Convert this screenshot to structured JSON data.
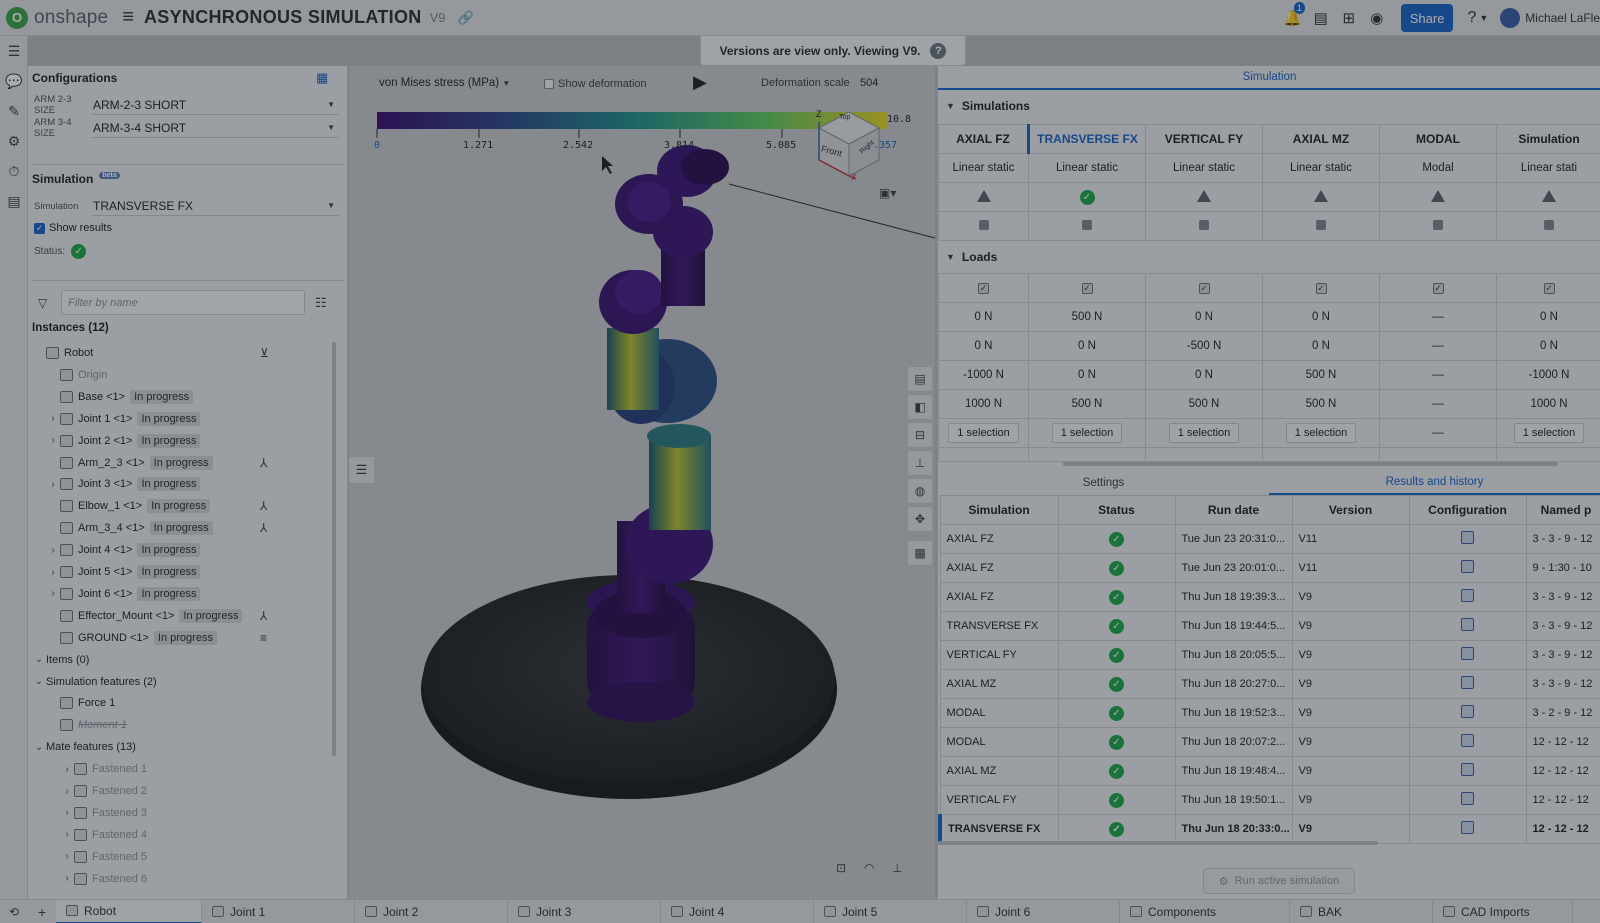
{
  "app": {
    "brand": "onshape",
    "doc_title": "ASYNCHRONOUS SIMULATION",
    "doc_version": "V9",
    "share_label": "Share",
    "notification_count": "1",
    "user_name": "Michael LaFle",
    "accent_color": "#1a63c6"
  },
  "banner": {
    "text": "Versions are view only. Viewing V9.",
    "help": "?"
  },
  "left_panel": {
    "configurations_title": "Configurations",
    "configs": [
      {
        "label": "ARM 2-3 SIZE",
        "value": "ARM-2-3 SHORT"
      },
      {
        "label": "ARM 3-4 SIZE",
        "value": "ARM-3-4 SHORT"
      }
    ],
    "simulation_title": "Simulation",
    "simulation_badge": "beta",
    "simulation_label": "Simulation",
    "simulation_value": "TRANSVERSE FX",
    "show_results": "Show results",
    "status_label": "Status:",
    "filter_placeholder": "Filter by name",
    "instances_title": "Instances (12)",
    "tree": [
      {
        "name": "Robot",
        "indent": 0,
        "expand": "",
        "badge": "",
        "icon": "assembly-icon"
      },
      {
        "name": "Origin",
        "indent": 1,
        "expand": "",
        "badge": "",
        "muted": true
      },
      {
        "name": "Base <1>",
        "indent": 1,
        "expand": "",
        "badge": "In progress"
      },
      {
        "name": "Joint 1 <1>",
        "indent": 1,
        "expand": ">",
        "badge": "In progress"
      },
      {
        "name": "Joint 2 <1>",
        "indent": 1,
        "expand": ">",
        "badge": "In progress"
      },
      {
        "name": "Arm_2_3 <1>",
        "indent": 1,
        "expand": "",
        "badge": "In progress",
        "icon": "mate-connector-icon"
      },
      {
        "name": "Joint 3 <1>",
        "indent": 1,
        "expand": ">",
        "badge": "In progress"
      },
      {
        "name": "Elbow_1 <1>",
        "indent": 1,
        "expand": "",
        "badge": "In progress",
        "icon": "mate-connector-icon"
      },
      {
        "name": "Arm_3_4 <1>",
        "indent": 1,
        "expand": "",
        "badge": "In progress",
        "icon": "mate-connector-icon"
      },
      {
        "name": "Joint 4 <1>",
        "indent": 1,
        "expand": ">",
        "badge": "In progress"
      },
      {
        "name": "Joint 5 <1>",
        "indent": 1,
        "expand": ">",
        "badge": "In progress"
      },
      {
        "name": "Joint 6 <1>",
        "indent": 1,
        "expand": ">",
        "badge": "In progress"
      },
      {
        "name": "Effector_Mount <1>",
        "indent": 1,
        "expand": "",
        "badge": "In progress",
        "icon": "mate-connector-icon"
      },
      {
        "name": "GROUND <1>",
        "indent": 1,
        "expand": "",
        "badge": "In progress",
        "icon": "ground-icon"
      },
      {
        "name": "Items (0)",
        "indent": 0,
        "expand": "v",
        "badge": "",
        "section": true
      },
      {
        "name": "Simulation features (2)",
        "indent": 0,
        "expand": "v",
        "badge": "",
        "section": true
      },
      {
        "name": "Force 1",
        "indent": 1,
        "expand": "",
        "badge": ""
      },
      {
        "name": "Moment 1",
        "indent": 1,
        "expand": "",
        "badge": "",
        "strike": true
      },
      {
        "name": "Mate features (13)",
        "indent": 0,
        "expand": "v",
        "badge": "",
        "section": true
      },
      {
        "name": "Fastened 1",
        "indent": 2,
        "expand": ">",
        "badge": "",
        "muted": true
      },
      {
        "name": "Fastened 2",
        "indent": 2,
        "expand": ">",
        "badge": "",
        "muted": true
      },
      {
        "name": "Fastened 3",
        "indent": 2,
        "expand": ">",
        "badge": "",
        "muted": true
      },
      {
        "name": "Fastened 4",
        "indent": 2,
        "expand": ">",
        "badge": "",
        "muted": true
      },
      {
        "name": "Fastened 5",
        "indent": 2,
        "expand": ">",
        "badge": "",
        "muted": true
      },
      {
        "name": "Fastened 6",
        "indent": 2,
        "expand": ">",
        "badge": "",
        "muted": true
      }
    ]
  },
  "viewport": {
    "result_type": "von Mises stress (MPa)",
    "show_deformation": "Show deformation",
    "deformation_scale_label": "Deformation scale",
    "deformation_scale_value": "504",
    "legend_ticks": [
      "0",
      "1.271",
      "2.542",
      "3.814",
      "5.085"
    ],
    "legend_max": "10.8",
    "legend_end": ".357",
    "viewcube_face": "Front",
    "viewcube_top": "Top",
    "viewcube_right": "Right",
    "axis_x": "X",
    "axis_z": "Z"
  },
  "right_panel": {
    "tab": "Simulation",
    "simulations_title": "Simulations",
    "loads_title": "Loads",
    "columns": [
      "AXIAL FZ",
      "TRANSVERSE FX",
      "VERTICAL FY",
      "AXIAL MZ",
      "MODAL",
      "Simulation"
    ],
    "types": [
      "Linear static",
      "Linear static",
      "Linear static",
      "Linear static",
      "Modal",
      "Linear stati"
    ],
    "status_row": [
      "warn",
      "ok",
      "warn",
      "warn",
      "warn",
      "warn"
    ],
    "loads_rows": [
      [
        "0 N",
        "500 N",
        "0 N",
        "0 N",
        "—",
        "0 N"
      ],
      [
        "0 N",
        "0 N",
        "-500 N",
        "0 N",
        "—",
        "0 N"
      ],
      [
        "-1000 N",
        "0 N",
        "0 N",
        "500 N",
        "—",
        "-1000 N"
      ],
      [
        "1000 N",
        "500 N",
        "500 N",
        "500 N",
        "—",
        "1000 N"
      ],
      [
        "1 selection",
        "1 selection",
        "1 selection",
        "1 selection",
        "—",
        "1 selection"
      ]
    ],
    "settings_tab": "Settings",
    "results_tab": "Results and history",
    "results_headers": [
      "Simulation",
      "Status",
      "Run date",
      "Version",
      "Configuration",
      "Named p"
    ],
    "results": [
      [
        "AXIAL FZ",
        "Tue Jun 23 20:31:0...",
        "V11",
        "3 - 3 - 9 - 12"
      ],
      [
        "AXIAL FZ",
        "Tue Jun 23 20:01:0...",
        "V11",
        "9 - 1:30 - 10"
      ],
      [
        "AXIAL FZ",
        "Thu Jun 18 19:39:3...",
        "V9",
        "3 - 3 - 9 - 12"
      ],
      [
        "TRANSVERSE FX",
        "Thu Jun 18 19:44:5...",
        "V9",
        "3 - 3 - 9 - 12"
      ],
      [
        "VERTICAL FY",
        "Thu Jun 18 20:05:5...",
        "V9",
        "3 - 3 - 9 - 12"
      ],
      [
        "AXIAL MZ",
        "Thu Jun 18 20:27:0...",
        "V9",
        "3 - 3 - 9 - 12"
      ],
      [
        "MODAL",
        "Thu Jun 18 19:52:3...",
        "V9",
        "3 - 2 - 9 - 12"
      ],
      [
        "MODAL",
        "Thu Jun 18 20:07:2...",
        "V9",
        "12 - 12 - 12"
      ],
      [
        "AXIAL MZ",
        "Thu Jun 18 19:48:4...",
        "V9",
        "12 - 12 - 12"
      ],
      [
        "VERTICAL FY",
        "Thu Jun 18 19:50:1...",
        "V9",
        "12 - 12 - 12"
      ],
      [
        "TRANSVERSE FX",
        "Thu Jun 18 20:33:0...",
        "V9",
        "12 - 12 - 12"
      ]
    ],
    "run_button": "Run active simulation"
  },
  "bottom_tabs": [
    "Robot",
    "Joint 1",
    "Joint 2",
    "Joint 3",
    "Joint 4",
    "Joint 5",
    "Joint 6",
    "Components",
    "BAK",
    "CAD Imports"
  ]
}
